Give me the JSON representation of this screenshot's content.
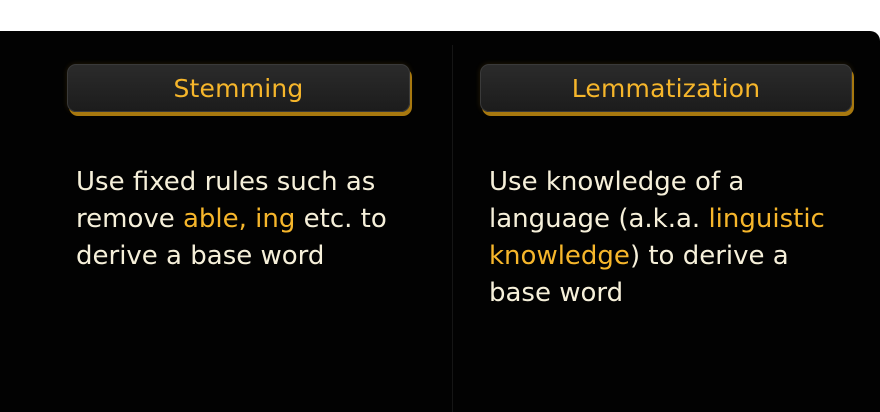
{
  "colors": {
    "accent": "#f6b62b",
    "text": "#f6f0da",
    "background": "#020202",
    "header_bg": "#262626"
  },
  "stemming": {
    "title": "Stemming",
    "line1": "Use fixed rules such as",
    "line2_pre": "remove ",
    "line2_highlight": "able, ing",
    "line2_post": " etc. to",
    "line3": "derive a base word"
  },
  "lemmatization": {
    "title": "Lemmatization",
    "line1": "Use knowledge of a",
    "line2_pre": "language (a.k.a. ",
    "line2_highlight": "linguistic",
    "line3_highlight": "knowledge",
    "line3_post": ") to derive a",
    "line4": "base word"
  }
}
